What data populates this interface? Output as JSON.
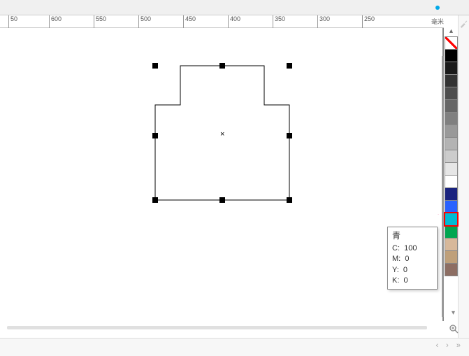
{
  "ruler": {
    "ticks": [
      "50",
      "600",
      "550",
      "500",
      "450",
      "400",
      "350",
      "300",
      "250"
    ],
    "unit_label": "毫米"
  },
  "selection": {
    "center_marker": "×"
  },
  "palette": {
    "colors": [
      {
        "name": "none",
        "hex": "none"
      },
      {
        "name": "black",
        "hex": "#000000"
      },
      {
        "name": "gray90",
        "hex": "#1a1a1a"
      },
      {
        "name": "gray80",
        "hex": "#333333"
      },
      {
        "name": "gray70",
        "hex": "#4d4d4d"
      },
      {
        "name": "gray60",
        "hex": "#666666"
      },
      {
        "name": "gray50",
        "hex": "#808080"
      },
      {
        "name": "gray40",
        "hex": "#999999"
      },
      {
        "name": "gray30",
        "hex": "#b3b3b3"
      },
      {
        "name": "gray20",
        "hex": "#cccccc"
      },
      {
        "name": "gray10",
        "hex": "#e6e6e6"
      },
      {
        "name": "white",
        "hex": "#ffffff"
      },
      {
        "name": "darkblue",
        "hex": "#1a237e"
      },
      {
        "name": "blue",
        "hex": "#2962ff"
      },
      {
        "name": "cyan",
        "hex": "#00bcd4"
      },
      {
        "name": "green",
        "hex": "#00a651"
      },
      {
        "name": "tan1",
        "hex": "#d7b89a"
      },
      {
        "name": "tan2",
        "hex": "#bfa07a"
      },
      {
        "name": "brown",
        "hex": "#8d6e63"
      }
    ],
    "highlighted_index": 14
  },
  "tooltip": {
    "name": "青",
    "c_label": "C:",
    "c_val": "100",
    "m_label": "M:",
    "m_val": "0",
    "y_label": "Y:",
    "y_val": "0",
    "k_label": "K:",
    "k_val": "0"
  },
  "nav": {
    "arrows": "‹  ›  »"
  }
}
